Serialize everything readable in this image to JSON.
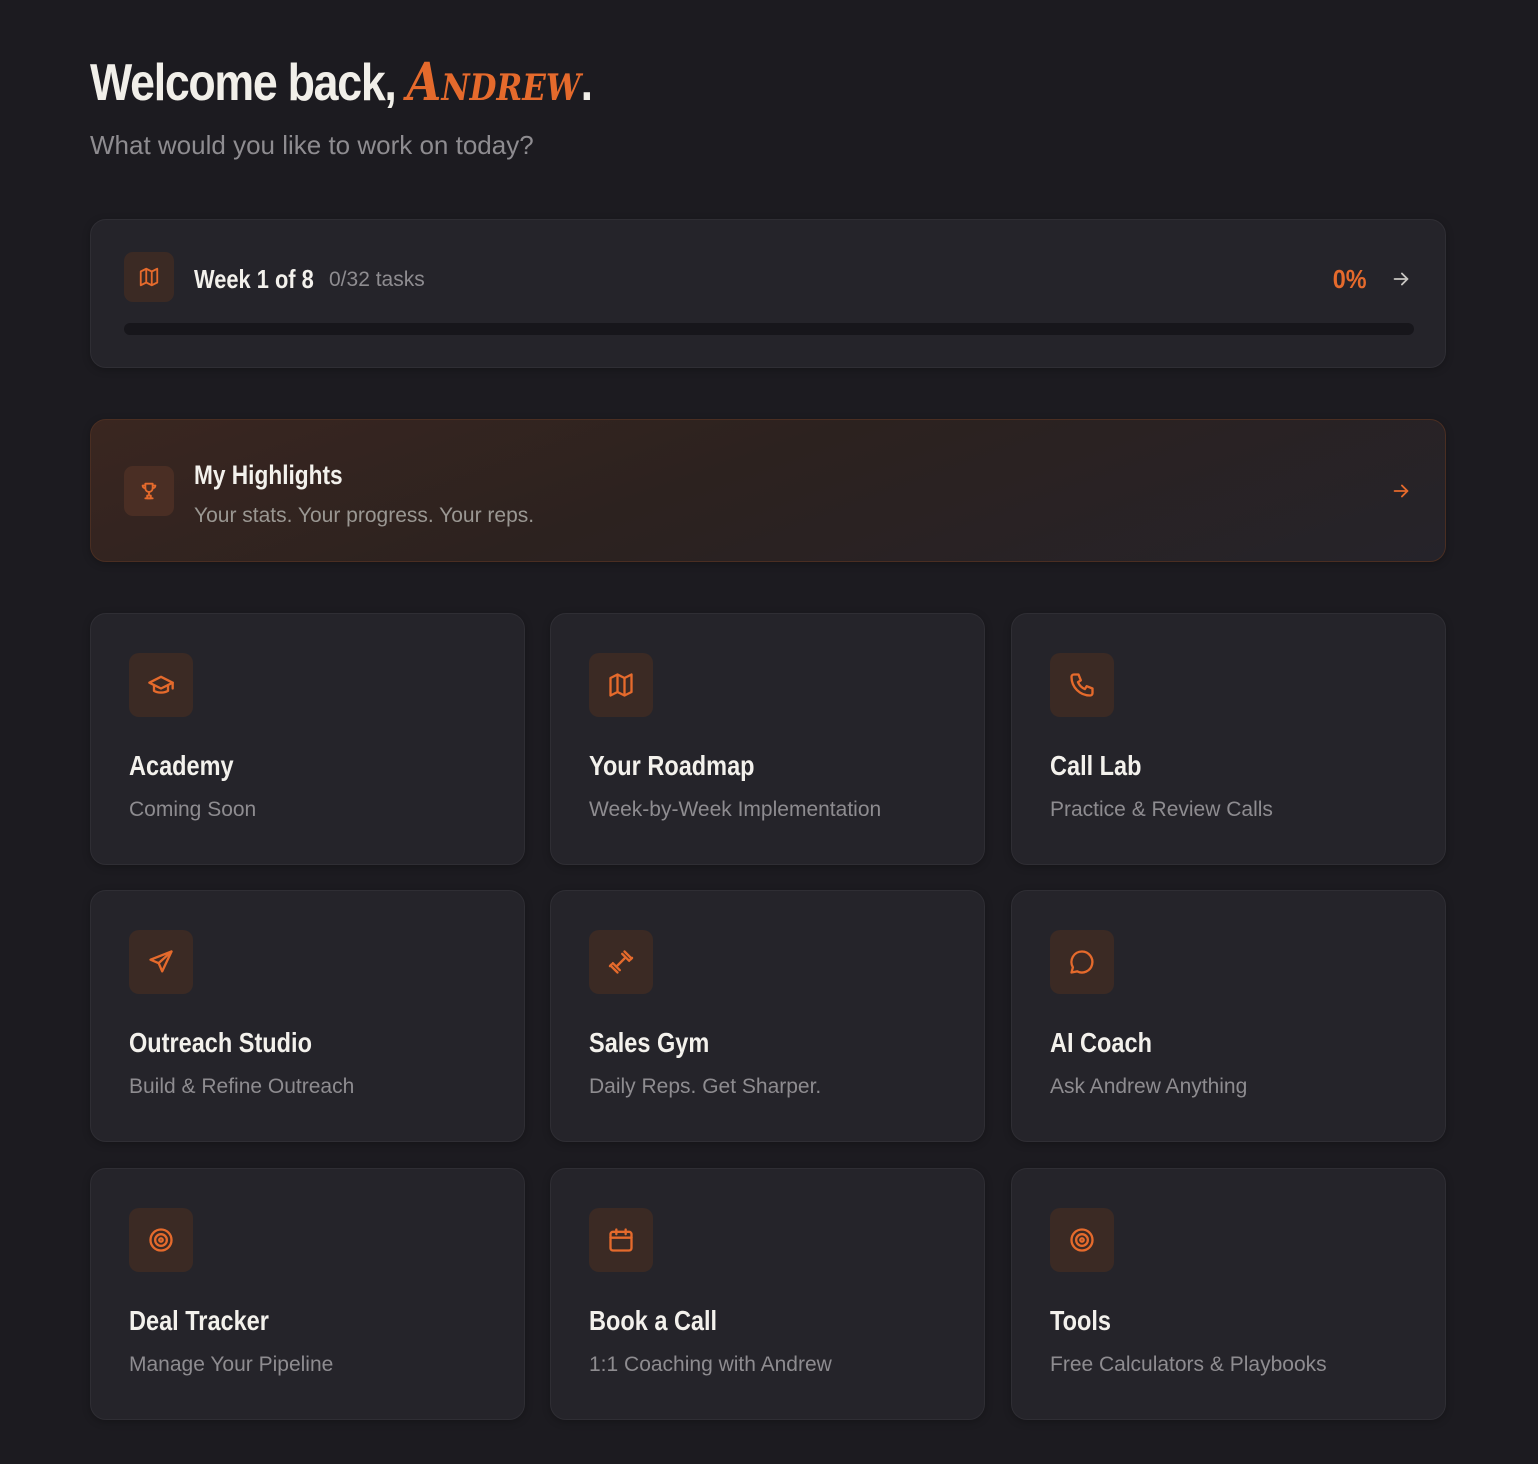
{
  "header": {
    "greeting_prefix": "Welcome back, ",
    "user_name": "Andrew",
    "greeting_suffix": ".",
    "subtitle": "What would you like to work on today?"
  },
  "progress": {
    "icon": "map-icon",
    "week_label": "Week 1 of 8",
    "tasks_label": "0/32 tasks",
    "percent_label": "0%",
    "percent_value": 0
  },
  "highlights": {
    "icon": "trophy-icon",
    "title": "My Highlights",
    "subtitle": "Your stats. Your progress. Your reps."
  },
  "tiles": [
    {
      "title": "Academy",
      "subtitle": "Coming Soon",
      "icon": "graduation-cap-icon"
    },
    {
      "title": "Your Roadmap",
      "subtitle": "Week-by-Week Implementation",
      "icon": "map-icon"
    },
    {
      "title": "Call Lab",
      "subtitle": "Practice & Review Calls",
      "icon": "phone-icon"
    },
    {
      "title": "Outreach Studio",
      "subtitle": "Build & Refine Outreach",
      "icon": "send-icon"
    },
    {
      "title": "Sales Gym",
      "subtitle": "Daily Reps. Get Sharper.",
      "icon": "dumbbell-icon"
    },
    {
      "title": "AI Coach",
      "subtitle": "Ask Andrew Anything",
      "icon": "chat-bubble-icon"
    },
    {
      "title": "Deal Tracker",
      "subtitle": "Manage Your Pipeline",
      "icon": "target-icon"
    },
    {
      "title": "Book a Call",
      "subtitle": "1:1 Coaching with Andrew",
      "icon": "calendar-icon"
    },
    {
      "title": "Tools",
      "subtitle": "Free Calculators & Playbooks",
      "icon": "target-icon"
    }
  ],
  "colors": {
    "accent": "#e56a2c",
    "background": "#1c1b20",
    "card": "#25242a"
  }
}
